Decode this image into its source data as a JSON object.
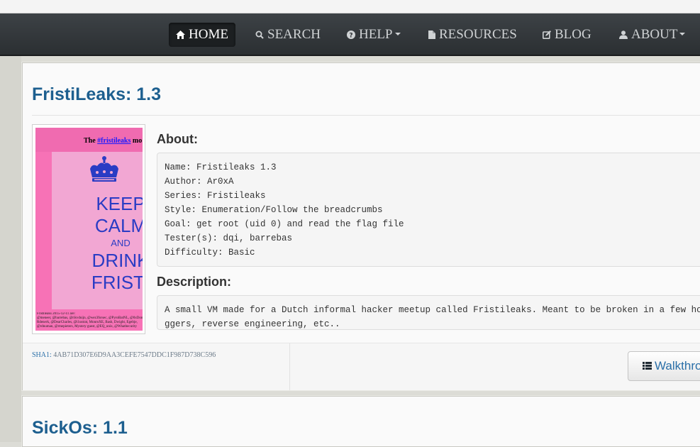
{
  "nav": {
    "home": "HOME",
    "search": "SEARCH",
    "help": "HELP",
    "resources": "RESOURCES",
    "blog": "BLOG",
    "about": "ABOUT",
    "icons": [
      "home-icon",
      "search-icon",
      "question-icon",
      "file-icon",
      "edit-icon",
      "user-icon"
    ]
  },
  "entries": [
    {
      "title": "FristiLeaks: 1.3",
      "about_heading": "About:",
      "about_lines": [
        "Name: Fristileaks 1.3",
        "Author: Ar0xA",
        "Series: Fristileaks",
        "Style: Enumeration/Follow the breadcrumbs",
        "Goal: get root (uid 0) and read the flag file",
        "Tester(s): dqi, barrebas",
        "Difficulty: Basic"
      ],
      "description_heading": "Description:",
      "description_lines": [
        "A small VM made for a Dutch informal hacker meetup called Fristileaks. Meant to be broken in a few hours",
        "ggers, reverse engineering, etc.."
      ],
      "sha1_label": "SHA1:",
      "sha1": "4AB71D307E6D9AA3CEFE7547DDC1F987D738C596",
      "walkthrough_label": "Walkthro",
      "poster": {
        "head_text": "The ",
        "head_link": "#fristileaks",
        "head_tail": " mo",
        "keep": "KEEP",
        "calm": "CALM",
        "and": "AND",
        "drink": "DRINK",
        "fristi": "FRISTI",
        "fine_lines": [
          "Fristileaks 2015-12-11 are:",
          "@meneer, @barrebas, @rikvduijn, @wez3forsec, @PyroBatNL, @0xDone",
          "Rdenerk, @DearCharles, @i1ustrat, MonroXE, Bash, Dwight, Egeltje,",
          "@rdnuman, @rmepieters, Mystery guest, @EQ_unix, @Whatbecurity"
        ]
      }
    },
    {
      "title": "SickOs: 1.1"
    }
  ],
  "colors": {
    "link": "#1d5f8f",
    "navbar": "#2b2f32",
    "poster_pink": "#f772b6",
    "poster_blue": "#2a3cc4"
  }
}
